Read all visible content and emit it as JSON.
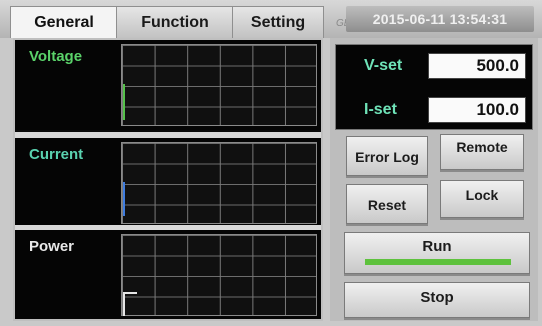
{
  "tabs": {
    "general": "General",
    "function": "Function",
    "setting": "Setting"
  },
  "brand": "GEMO",
  "clock": "2015-06-11 13:54:31",
  "panels": {
    "voltage": "Voltage",
    "current": "Current",
    "power": "Power"
  },
  "settings": {
    "vset_label": "V-set",
    "vset_value": "500.0",
    "iset_label": "I-set",
    "iset_value": "100.0"
  },
  "buttons": {
    "error_log": "Error Log",
    "remote": "Remote",
    "reset": "Reset",
    "lock": "Lock",
    "run": "Run",
    "stop": "Stop"
  },
  "colors": {
    "voltage_label": "#5ad26a",
    "current_label": "#5ad2b0",
    "power_label": "#e8e8e8",
    "run_indicator": "#5ec23d"
  }
}
